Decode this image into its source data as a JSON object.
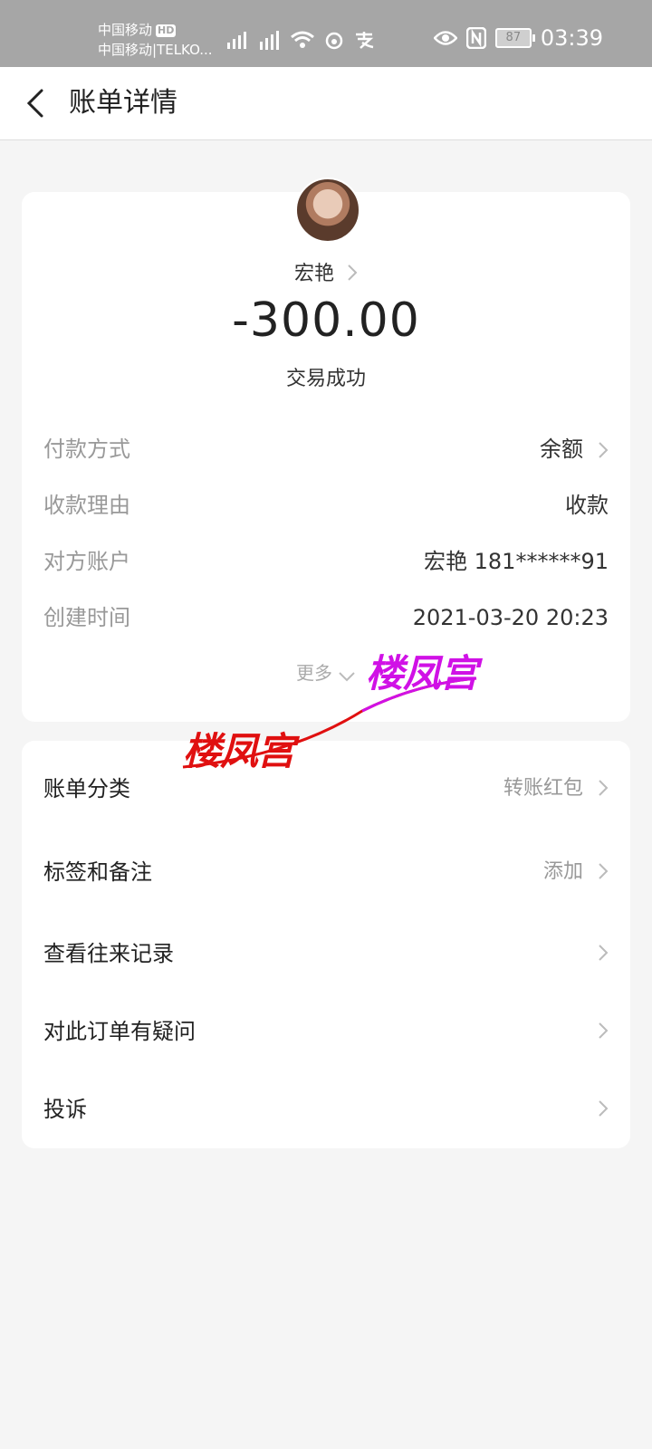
{
  "status_bar": {
    "carrier_1": "中国移动",
    "hd_badge": "HD",
    "carrier_2": "中国移动|TELKO...",
    "battery": "87",
    "time": "03:39"
  },
  "header": {
    "title": "账单详情"
  },
  "summary": {
    "payee_name": "宏艳",
    "amount": "-300.00",
    "status": "交易成功"
  },
  "details": [
    {
      "label": "付款方式",
      "value": "余额"
    },
    {
      "label": "收款理由",
      "value": "收款"
    },
    {
      "label": "对方账户",
      "value": "宏艳 181******91"
    },
    {
      "label": "创建时间",
      "value": "2021-03-20 20:23"
    }
  ],
  "more_label": "更多",
  "menu": [
    {
      "label": "账单分类",
      "value": "转账红包"
    },
    {
      "label": "标签和备注",
      "value": "添加"
    },
    {
      "label": "查看往来记录",
      "value": ""
    },
    {
      "label": "对此订单有疑问",
      "value": ""
    },
    {
      "label": "投诉",
      "value": ""
    }
  ],
  "watermark": {
    "text_1": "楼凤宫",
    "text_2": "楼凤宫"
  },
  "colors": {
    "status_bar": "#a6a6a6",
    "background": "#f5f5f5",
    "watermark_red": "#e01010",
    "watermark_purple": "#d011e6"
  }
}
